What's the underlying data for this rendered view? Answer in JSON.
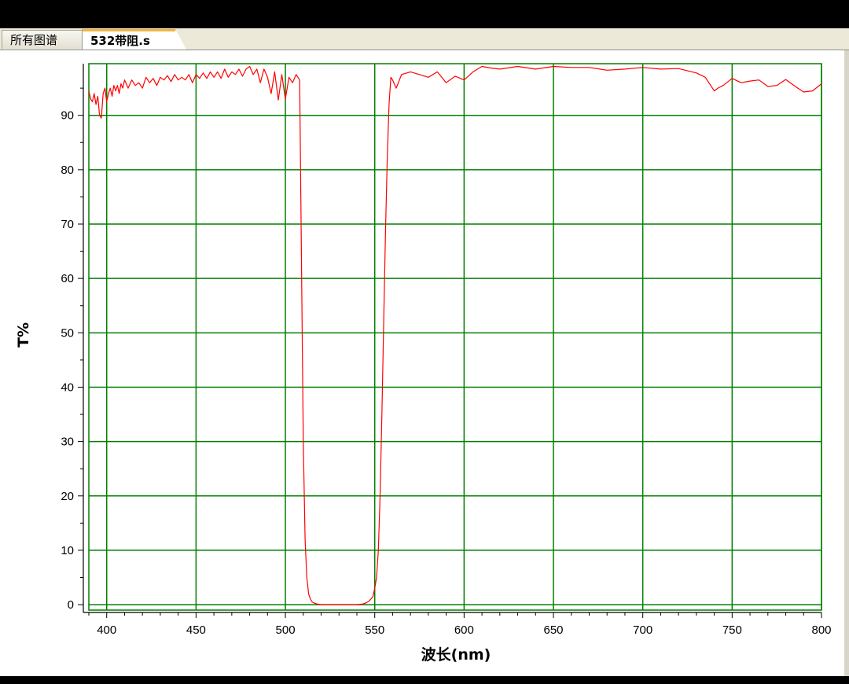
{
  "tabs": [
    {
      "label": "所有图谱",
      "active": false
    },
    {
      "label": "532带阻.s",
      "active": true
    }
  ],
  "colors": {
    "grid": "#008000",
    "curve": "#ff0000",
    "tab_accent": "#f5b53e"
  },
  "chart_data": {
    "type": "line",
    "xlabel": "波长(nm)",
    "ylabel": "T%",
    "xlim": [
      390,
      800
    ],
    "ylim": [
      -1,
      99.5
    ],
    "grid": true,
    "x_ticks": [
      400,
      450,
      500,
      550,
      600,
      650,
      700,
      750,
      800
    ],
    "y_ticks": [
      0,
      10,
      20,
      30,
      40,
      50,
      60,
      70,
      80,
      90
    ],
    "series": [
      {
        "color": "#ff0000",
        "x": [
          390,
          391,
          392,
          393,
          394,
          395,
          396,
          397,
          398,
          399,
          400,
          401,
          402,
          403,
          404,
          405,
          406,
          407,
          408,
          409,
          410,
          412,
          414,
          416,
          418,
          420,
          422,
          424,
          426,
          428,
          430,
          432,
          434,
          436,
          438,
          440,
          442,
          444,
          446,
          448,
          450,
          452,
          454,
          456,
          458,
          460,
          462,
          464,
          466,
          468,
          470,
          472,
          474,
          476,
          478,
          480,
          482,
          484,
          486,
          488,
          490,
          492,
          494,
          496,
          498,
          500,
          502,
          504,
          506,
          508,
          510,
          511,
          512,
          513,
          514,
          515,
          516,
          518,
          520,
          525,
          530,
          535,
          540,
          543,
          545,
          547,
          549,
          550,
          551,
          552,
          553,
          554,
          555,
          556,
          557,
          558,
          559,
          560,
          562,
          565,
          570,
          575,
          580,
          585,
          590,
          595,
          600,
          605,
          610,
          615,
          620,
          630,
          640,
          650,
          660,
          670,
          680,
          690,
          700,
          710,
          720,
          730,
          735,
          740,
          742,
          745,
          750,
          755,
          760,
          765,
          770,
          775,
          780,
          785,
          790,
          795,
          800
        ],
        "y": [
          94.5,
          93,
          92.5,
          94,
          92,
          93.5,
          90,
          89.5,
          94,
          95,
          92.5,
          94,
          95,
          93.5,
          95.5,
          94.5,
          95.5,
          94,
          95.8,
          95,
          96.5,
          95,
          96.5,
          95.5,
          96,
          95,
          97,
          96,
          96.8,
          95.5,
          97,
          96.5,
          97.3,
          96.2,
          97.5,
          96.5,
          97,
          96.5,
          97.5,
          96,
          97.5,
          96.8,
          97.8,
          96.8,
          98,
          97,
          98,
          96.8,
          98.5,
          97,
          98,
          97.5,
          98.5,
          97.2,
          98.5,
          99,
          97.5,
          98.5,
          96,
          98.5,
          97,
          94,
          98,
          92.8,
          97.5,
          93,
          97,
          96,
          97.5,
          96.5,
          30,
          12,
          5,
          2,
          1,
          0.5,
          0.3,
          0.1,
          0,
          0,
          0,
          0,
          0,
          0.1,
          0.3,
          0.7,
          1.5,
          3,
          5,
          10,
          20,
          35,
          52,
          68,
          82,
          92,
          97,
          96.5,
          95,
          97.5,
          98,
          97.5,
          97,
          98,
          96,
          97.2,
          96.5,
          98,
          99,
          98.7,
          98.5,
          99,
          98.5,
          99,
          98.8,
          98.8,
          98.3,
          98.5,
          98.8,
          98.5,
          98.6,
          97.8,
          97,
          94.5,
          95,
          95.5,
          96.8,
          96,
          96.3,
          96.5,
          95.3,
          95.5,
          96.6,
          95.4,
          94.3,
          94.5,
          95.8
        ]
      }
    ]
  }
}
